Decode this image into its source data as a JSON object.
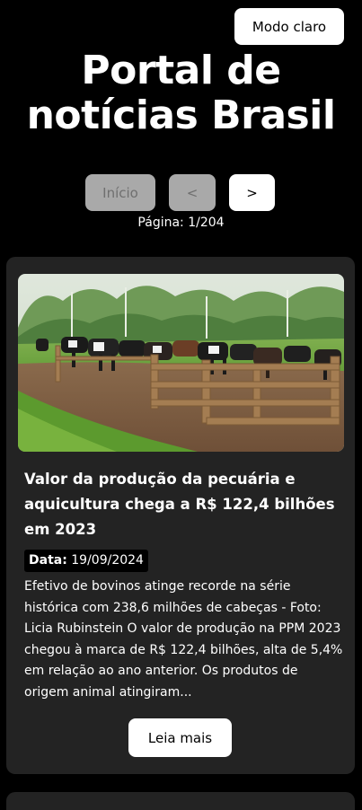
{
  "header": {
    "theme_toggle_label": "Modo claro",
    "site_title": "Portal de notícias Brasil"
  },
  "pagination": {
    "start_label": "Início",
    "prev_label": "<",
    "next_label": ">",
    "page_label": "Página: 1/204"
  },
  "articles": [
    {
      "title": "Valor da produção da pecuária e aquicultura chega a R$ 122,4 bilhões em 2023",
      "date_label": "Data:",
      "date": "19/09/2024",
      "excerpt": "Efetivo de bovinos atinge recorde na série histórica com 238,6 milhões de cabeças - Foto: Licia Rubinstein O valor de produção na PPM 2023 chegou à marca de R$ 122,4 bilhões, alta de 5,4% em relação ao ano anterior. Os produtos de origem animal atingiram...",
      "read_more_label": "Leia mais",
      "image": "cattle-herd-in-pasture"
    }
  ],
  "colors": {
    "background": "#000000",
    "card": "#232323",
    "button": "#ffffff",
    "button_disabled": "#a9a9a9"
  }
}
